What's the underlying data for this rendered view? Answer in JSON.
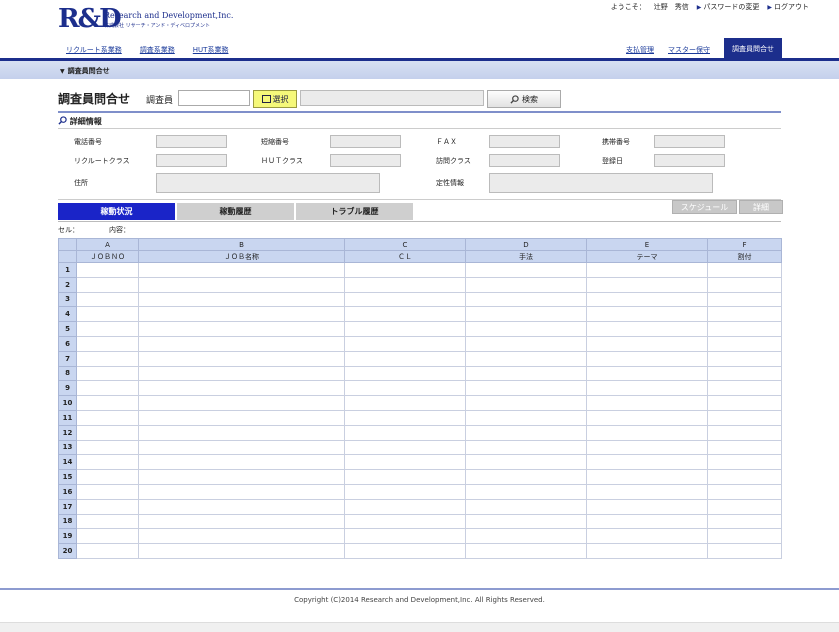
{
  "logo": {
    "mark": "R&D",
    "company": "Research and Development,Inc.",
    "company_jp": "株式会社 リサーチ・アンド・ディベロプメント"
  },
  "userbar": {
    "welcome": "ようこそ：",
    "user_name": "辻野　秀信",
    "change_password": "パスワードの変更",
    "logout": "ログアウト"
  },
  "nav": {
    "left": [
      "リクルート系業務",
      "調査系業務",
      "HUT系業務"
    ],
    "right": [
      "支払管理",
      "マスター保守"
    ],
    "active": "調査員問合せ"
  },
  "breadcrumb": "調査員問合せ",
  "page": {
    "title": "調査員問合せ",
    "inquirer_label": "調査員",
    "inquirer_value": "",
    "select_button": "選択",
    "name_value": "",
    "search_button": "検索"
  },
  "details": {
    "title": "詳細情報",
    "labels": {
      "phone": "電話番号",
      "short_num": "短縮番号",
      "fax": "ＦＡＸ",
      "mobile": "携帯番号",
      "recruit_class": "リクルートクラス",
      "hut_class": "ＨＵＴクラス",
      "visit_class": "訪問クラス",
      "reg_date": "登録日",
      "address": "住所",
      "qualitative": "定性情報"
    }
  },
  "tabs": [
    "稼動状況",
    "稼動履歴",
    "トラブル履歴"
  ],
  "actions": {
    "schedule": "スケジュール",
    "detail": "詳細"
  },
  "cellinfo": {
    "cell_label": "セル：",
    "content_label": "内容："
  },
  "grid": {
    "col_letters": [
      "A",
      "B",
      "C",
      "D",
      "E",
      "F"
    ],
    "headers": [
      "ＪＯＢＮＯ",
      "ＪＯＢ名称",
      "ＣＬ",
      "手法",
      "テーマ",
      "割付"
    ],
    "row_count": 20
  },
  "footer": "Copyright (C)2014 Research and Development,Inc. All Rights Reserved."
}
